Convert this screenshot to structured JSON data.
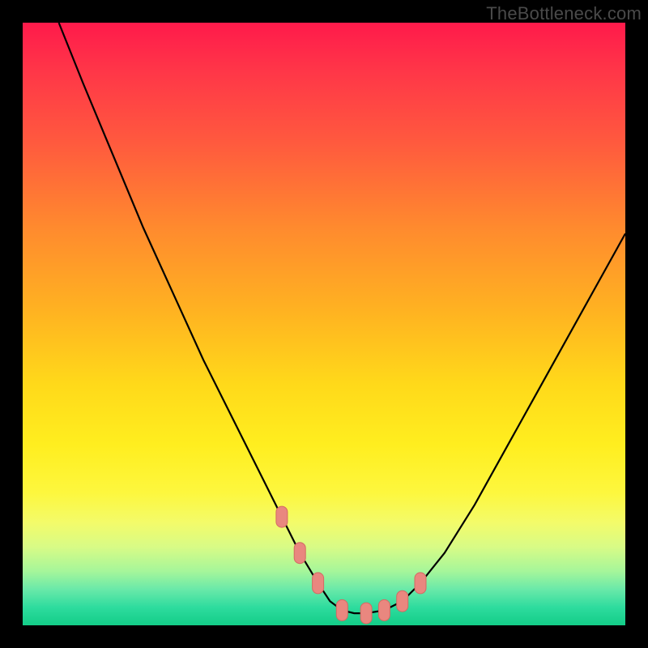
{
  "attribution": "TheBottleneck.com",
  "colors": {
    "background": "#000000",
    "curve": "#000000",
    "marker_fill": "#e9877f",
    "marker_stroke": "#d46a63"
  },
  "chart_data": {
    "type": "line",
    "title": "",
    "xlabel": "",
    "ylabel": "",
    "xlim": [
      0,
      100
    ],
    "ylim": [
      0,
      100
    ],
    "series": [
      {
        "name": "bottleneck-curve",
        "x": [
          6,
          10,
          15,
          20,
          25,
          30,
          35,
          40,
          43,
          46,
          49,
          51,
          53,
          55,
          57,
          60,
          63,
          66,
          70,
          75,
          80,
          85,
          90,
          95,
          100
        ],
        "values": [
          100,
          90,
          78,
          66,
          55,
          44,
          34,
          24,
          18,
          12,
          7,
          4,
          2.5,
          2,
          2,
          2.5,
          4,
          7,
          12,
          20,
          29,
          38,
          47,
          56,
          65
        ]
      }
    ],
    "markers": {
      "name": "highlight-points",
      "x": [
        43,
        46,
        49,
        53,
        57,
        60,
        63,
        66
      ],
      "values": [
        18,
        12,
        7,
        2.5,
        2,
        2.5,
        4,
        7
      ]
    }
  }
}
